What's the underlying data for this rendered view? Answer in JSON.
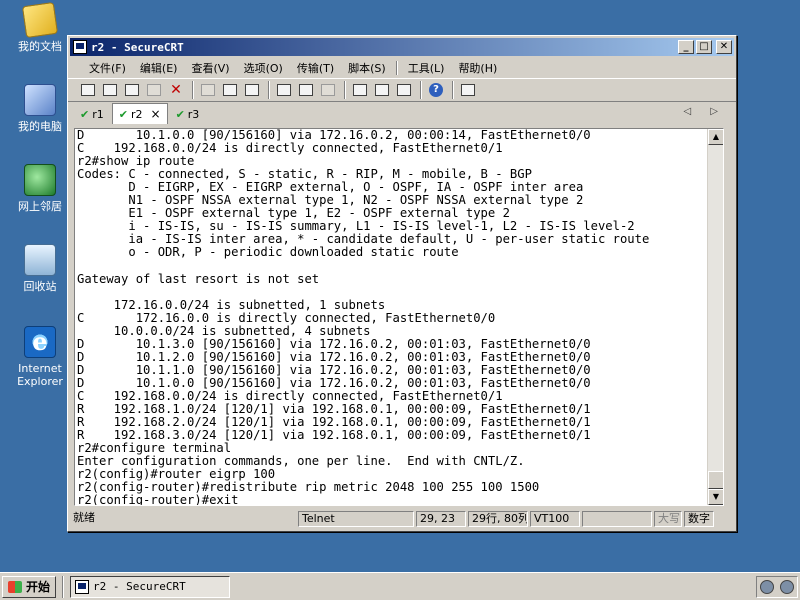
{
  "desktop": {
    "icons": [
      {
        "label": "我的文档",
        "icon": "my-documents-icon"
      },
      {
        "label": "我的电脑",
        "icon": "my-computer-icon"
      },
      {
        "label": "网上邻居",
        "icon": "network-neighborhood-icon"
      },
      {
        "label": "回收站",
        "icon": "recycle-bin-icon"
      },
      {
        "label": "Internet Explorer",
        "icon": "internet-explorer-icon"
      }
    ]
  },
  "window": {
    "title": "r2 - SecureCRT",
    "controls": {
      "minimize": "_",
      "maximize": "□",
      "close": "✕"
    }
  },
  "menu": {
    "items": [
      "文件(F)",
      "编辑(E)",
      "查看(V)",
      "选项(O)",
      "传输(T)",
      "脚本(S)",
      "工具(L)",
      "帮助(H)"
    ]
  },
  "tabs": {
    "items": [
      {
        "label": "r1",
        "active": false
      },
      {
        "label": "r2",
        "active": true
      },
      {
        "label": "r3",
        "active": false
      }
    ],
    "close_glyph": "×",
    "check_glyph": "✔",
    "arrows": "◁ ▷"
  },
  "terminal": {
    "lines": [
      "D       10.1.0.0 [90/156160] via 172.16.0.2, 00:00:14, FastEthernet0/0",
      "C    192.168.0.0/24 is directly connected, FastEthernet0/1",
      "r2#show ip route",
      "Codes: C - connected, S - static, R - RIP, M - mobile, B - BGP",
      "       D - EIGRP, EX - EIGRP external, O - OSPF, IA - OSPF inter area",
      "       N1 - OSPF NSSA external type 1, N2 - OSPF NSSA external type 2",
      "       E1 - OSPF external type 1, E2 - OSPF external type 2",
      "       i - IS-IS, su - IS-IS summary, L1 - IS-IS level-1, L2 - IS-IS level-2",
      "       ia - IS-IS inter area, * - candidate default, U - per-user static route",
      "       o - ODR, P - periodic downloaded static route",
      "",
      "Gateway of last resort is not set",
      "",
      "     172.16.0.0/24 is subnetted, 1 subnets",
      "C       172.16.0.0 is directly connected, FastEthernet0/0",
      "     10.0.0.0/24 is subnetted, 4 subnets",
      "D       10.1.3.0 [90/156160] via 172.16.0.2, 00:01:03, FastEthernet0/0",
      "D       10.1.2.0 [90/156160] via 172.16.0.2, 00:01:03, FastEthernet0/0",
      "D       10.1.1.0 [90/156160] via 172.16.0.2, 00:01:03, FastEthernet0/0",
      "D       10.1.0.0 [90/156160] via 172.16.0.2, 00:01:03, FastEthernet0/0",
      "C    192.168.0.0/24 is directly connected, FastEthernet0/1",
      "R    192.168.1.0/24 [120/1] via 192.168.0.1, 00:00:09, FastEthernet0/1",
      "R    192.168.2.0/24 [120/1] via 192.168.0.1, 00:00:09, FastEthernet0/1",
      "R    192.168.3.0/24 [120/1] via 192.168.0.1, 00:00:09, FastEthernet0/1",
      "r2#configure terminal",
      "Enter configuration commands, one per line.  End with CNTL/Z.",
      "r2(config)#router eigrp 100",
      "r2(config-router)#redistribute rip metric 2048 100 255 100 1500",
      "r2(config-router)#exit"
    ]
  },
  "status": {
    "ready": "就绪",
    "protocol": "Telnet",
    "cursor": "29, 23",
    "size": "29行, 80列",
    "emulation": "VT100",
    "blank": "",
    "caps": "大写",
    "num": "数字"
  },
  "taskbar": {
    "start_label": "开始",
    "task_label": "r2 - SecureCRT"
  }
}
